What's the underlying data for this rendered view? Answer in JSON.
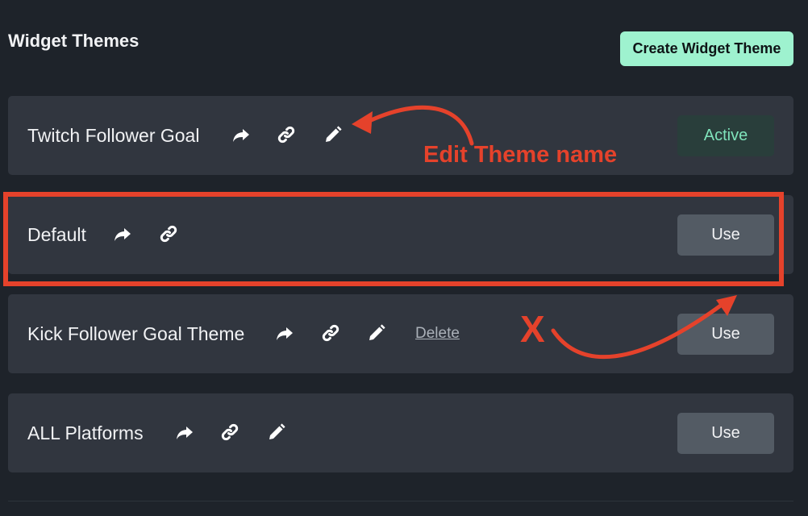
{
  "header": {
    "title": "Widget Themes",
    "create_button_label": "Create Widget Theme"
  },
  "themes": [
    {
      "name": "Twitch Follower Goal",
      "button_label": "Active",
      "has_edit": true,
      "has_delete": false
    },
    {
      "name": "Default",
      "button_label": "Use",
      "has_edit": false,
      "has_delete": false
    },
    {
      "name": "Kick Follower Goal Theme",
      "button_label": "Use",
      "has_edit": true,
      "has_delete": true,
      "delete_label": "Delete"
    },
    {
      "name": "ALL Platforms",
      "button_label": "Use",
      "has_edit": true,
      "has_delete": false
    }
  ],
  "annotations": {
    "edit_theme_text": "Edit Theme name",
    "x_mark": "X",
    "color": "#e5422b"
  },
  "icons": [
    "share-icon",
    "link-icon",
    "pencil-icon"
  ],
  "colors": {
    "background": "#1e232a",
    "row": "#31363f",
    "accent_button": "#9ef2cf",
    "active_button_bg": "#293e3b",
    "active_button_text": "#7fe3bb",
    "use_button": "#535b64"
  }
}
